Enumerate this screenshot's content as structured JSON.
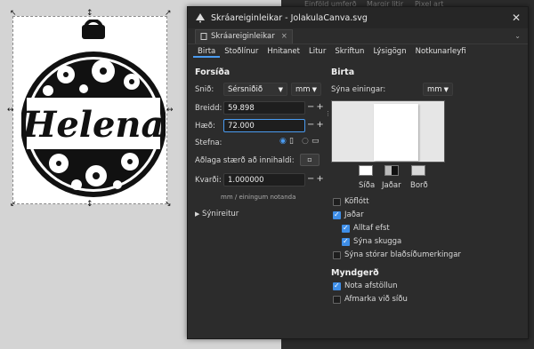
{
  "background_panel": {
    "faded_items": [
      "Einföld umferð",
      "Margir litir",
      "Pixel art"
    ]
  },
  "canvas": {
    "ornament_name": "Helena"
  },
  "dialog": {
    "title": "Skráareiginleikar - JolakulaCanva.svg",
    "doc_tab_label": "Skráareiginleikar",
    "doc_tab_close": "×",
    "close_symbol": "✕",
    "tabs": [
      "Birta",
      "Stoðlínur",
      "Hnitanet",
      "Litur",
      "Skriftun",
      "Lýsigögn",
      "Notkunarleyfi"
    ],
    "left": {
      "heading": "Forsíða",
      "format_label": "Snið:",
      "format_value": "Sérsniðið",
      "unit_value": "mm",
      "width_label": "Breidd:",
      "width_value": "59.898",
      "height_label": "Hæð:",
      "height_value": "72.000",
      "orientation_label": "Stefna:",
      "fit_label": "Aðlaga stærð að innihaldi:",
      "scale_label": "Kvarði:",
      "scale_value": "1.000000",
      "scale_note": "mm / einingum notanda",
      "viewbox_label": "Sýnireitur",
      "plus_minus": "−+"
    },
    "right": {
      "heading": "Birta",
      "units_label": "Sýna einingar:",
      "units_value": "mm",
      "swatch_labels": [
        "Síða",
        "Jaðar",
        "Borð"
      ],
      "checkboxes": [
        {
          "label": "Köflótt",
          "checked": false
        },
        {
          "label": "Jaðar",
          "checked": true
        },
        {
          "label": "Alltaf efst",
          "checked": true
        },
        {
          "label": "Sýna skugga",
          "checked": true
        },
        {
          "label": "Sýna stórar blaðsíðumerkingar",
          "checked": false
        }
      ],
      "heading2": "Myndgerð",
      "render_checkboxes": [
        {
          "label": "Nota afstöllun",
          "checked": true
        },
        {
          "label": "Afmarka við síðu",
          "checked": false
        }
      ]
    },
    "colors": {
      "accent": "#3e8ee8",
      "dialog_bg": "#2c2c2c",
      "canvas_bg": "#d4d4d4"
    }
  }
}
